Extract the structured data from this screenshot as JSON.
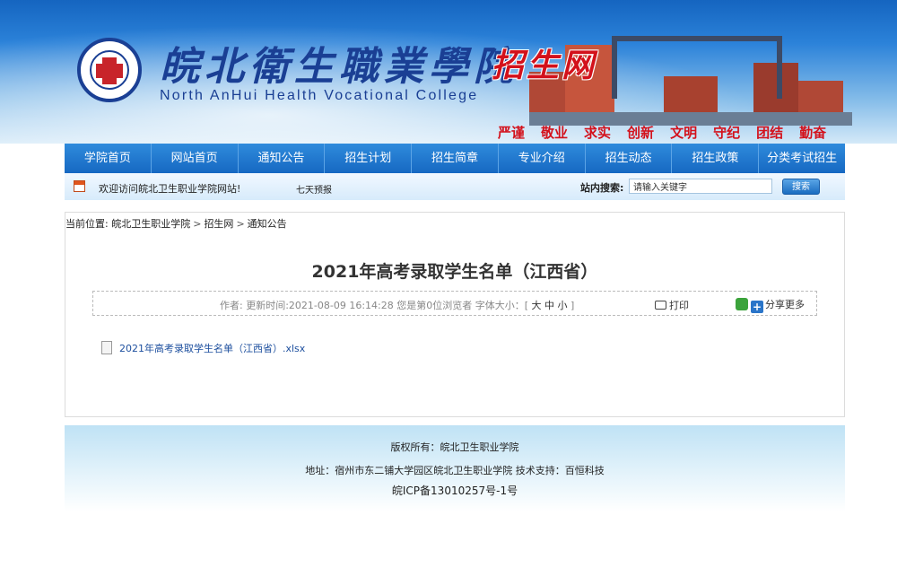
{
  "header": {
    "cn_name": "皖北衛生職業學院",
    "en_name": "North AnHui Health Vocational College",
    "site_name": "招生网",
    "mottos": [
      "严谨",
      "敬业",
      "求实",
      "创新",
      "文明",
      "守纪",
      "团结",
      "勤奋"
    ]
  },
  "nav": {
    "items": [
      "学院首页",
      "网站首页",
      "通知公告",
      "招生计划",
      "招生简章",
      "专业介绍",
      "招生动态",
      "招生政策",
      "分类考试招生"
    ]
  },
  "infobar": {
    "welcome": "欢迎访问皖北卫生职业学院网站!",
    "weather": "七天预报",
    "search_label": "站内搜索:",
    "search_placeholder": "请输入关键字",
    "search_button": "搜索"
  },
  "breadcrumb": {
    "prefix": "当前位置:",
    "items": [
      "皖北卫生职业学院",
      "招生网",
      "通知公告"
    ],
    "separator": ">"
  },
  "article": {
    "title": "2021年高考录取学生名单（江西省）",
    "meta": "作者:    更新时间:2021-08-09 16:14:28 您是第0位浏览者 字体大小：[",
    "font_sizes": "大 中 小",
    "meta_end": "]",
    "print": "打印",
    "share": "分享更多",
    "attachment": "2021年高考录取学生名单（江西省）.xlsx"
  },
  "footer": {
    "copyright": "版权所有：皖北卫生职业学院",
    "address": "地址：宿州市东二铺大学园区皖北卫生职业学院 技术支持：百恒科技",
    "icp": "皖ICP备13010257号-1号"
  },
  "colors": {
    "nav_blue": "#1668c2",
    "brand_blue": "#1a3f94",
    "brand_red": "#d3111b",
    "link_blue": "#1d4f9e"
  }
}
